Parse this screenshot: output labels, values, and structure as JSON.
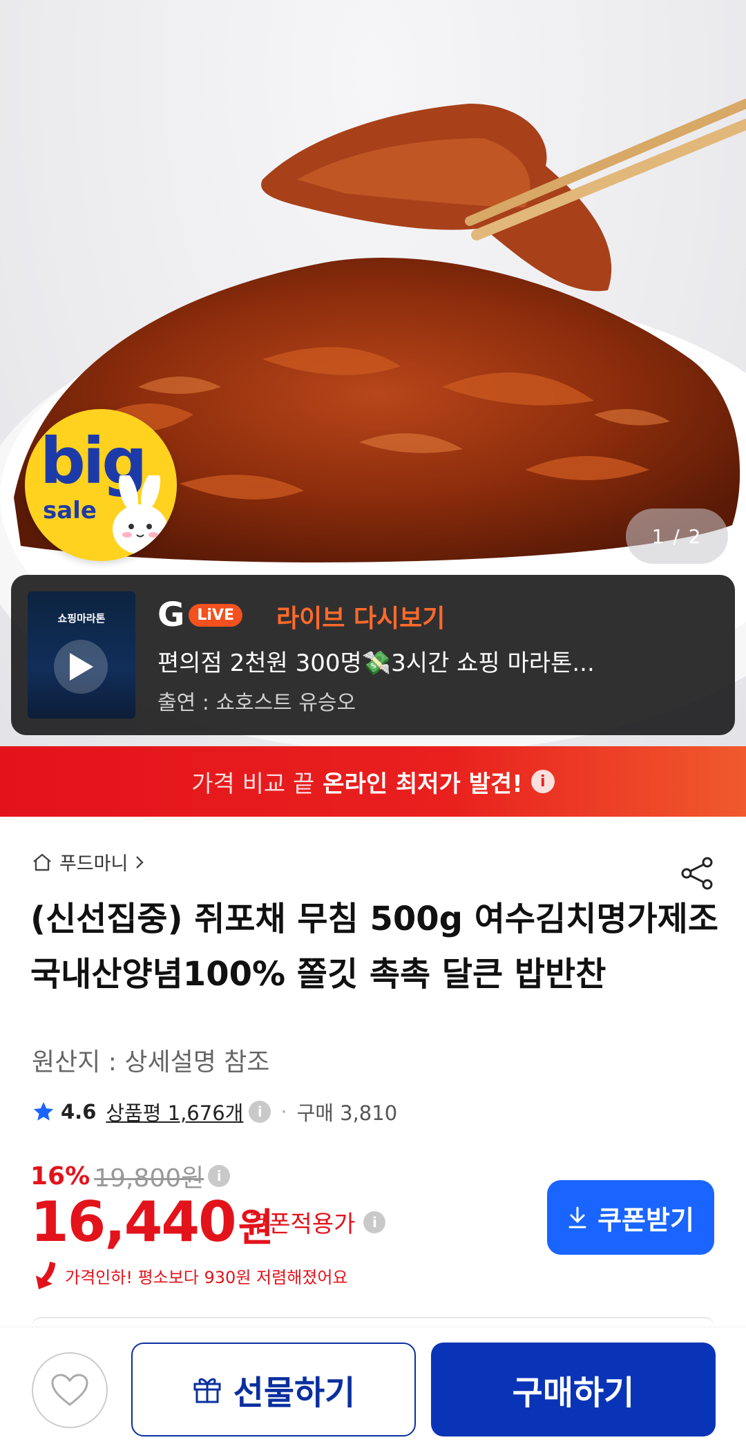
{
  "hero": {
    "badge_big": "big",
    "badge_sale": "sale",
    "image_counter": "1 / 2"
  },
  "live": {
    "thumb_title": "쇼핑마라톤",
    "g_letter": "G",
    "pill": "LiVE",
    "label": "라이브 다시보기",
    "title": "편의점 2천원 300명💸3시간 쇼핑 마라톤...",
    "cast": "출연 : 쇼호스트 유승오"
  },
  "promo": {
    "light": "가격 비교 끝",
    "strong": "온라인 최저가 발견!",
    "info": "i"
  },
  "product": {
    "breadcrumb": "푸드마니",
    "title": "(신선집중) 쥐포채 무침 500g 여수김치명가제조 국내산양념100% 쫄깃 촉촉 달큰 밥반찬",
    "origin": "원산지 : 상세설명 참조",
    "rating": "4.6",
    "reviews": "상품평 1,676개",
    "purchases": "구매 3,810"
  },
  "price": {
    "discount": "16%",
    "original": "19,800원",
    "final": "16,440",
    "won": "원",
    "coupon_apply": "쿠폰적용가",
    "coupon_button": "쿠폰받기",
    "price_drop": "가격인하! 평소보다 930원 저렴해졌어요"
  },
  "bottom": {
    "gift": "선물하기",
    "buy": "구매하기"
  },
  "colors": {
    "accent_red": "#e3131b",
    "coupon_blue": "#1a64ff",
    "buy_navy": "#0a34b8",
    "live_orange": "#ff6a2b"
  }
}
